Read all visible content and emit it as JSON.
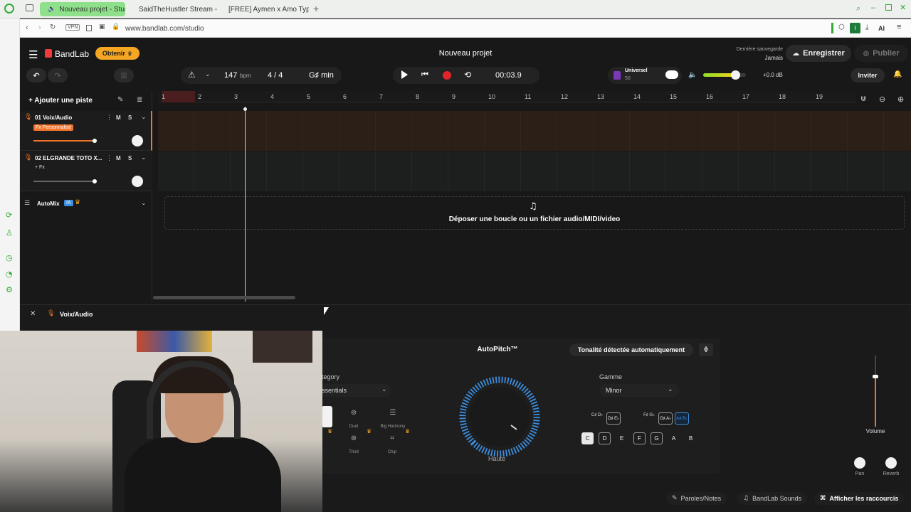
{
  "browser": {
    "tabs": [
      "Nouveau projet - Stud",
      "SaidTheHustler Stream - ",
      "[FREE] Aymen x Amo Type"
    ],
    "url": "www.bandlab.com/studio",
    "vpn": "VPN",
    "ai": "AI"
  },
  "header": {
    "brand": "BandLab",
    "obtenir": "Obtenir",
    "title": "Nouveau projet",
    "save_status_label": "Dernière sauvegarde",
    "save_status_value": "Jamais",
    "save_button": "Enregistrer",
    "publish_button": "Publier"
  },
  "transport": {
    "bpm": "147",
    "bpm_unit": "bpm",
    "signature": "4 / 4",
    "key": "G♯ min",
    "time": "00:03.9",
    "tuner_name": "Universel",
    "tuner_sub": "50",
    "gain": "+0.0 dB",
    "volume_level": 0.75,
    "invite": "Inviter"
  },
  "tracks": {
    "add_track": "Ajouter une piste",
    "items": [
      {
        "name": "01 Voix/Audio",
        "fx": "Fx Personnalisé",
        "mute": "M",
        "solo": "S"
      },
      {
        "name": "02 ELGRANDE TOTO X...",
        "fx": "+ Fx",
        "mute": "M",
        "solo": "S"
      }
    ],
    "automix": "AutoMix",
    "automix_badge": "IA"
  },
  "ruler": [
    "1",
    "2",
    "3",
    "4",
    "5",
    "6",
    "7",
    "8",
    "9",
    "10",
    "11",
    "12",
    "13",
    "14",
    "15",
    "16",
    "17",
    "18",
    "19"
  ],
  "dropzone": "Déposer une boucle ou un fichier audio/MIDI/video",
  "panel": {
    "track_name": "Voix/Audio",
    "category_label": "tegory",
    "category_value": "ssentials",
    "presets": [
      "Duet",
      "Big Harmony",
      "Third",
      "Chip"
    ],
    "autopitch_title": "AutoPitch™",
    "auto_key_button": "Tonalité détectée automatiquement",
    "knob_label": "Haute",
    "scale_label": "Gamme",
    "scale_value": "Minor",
    "sharps": [
      "C♯ D♭",
      "D♯ E♭",
      "F♯ G♭",
      "G♯ A♭",
      "A♯ B♭"
    ],
    "naturals": [
      "C",
      "D",
      "E",
      "F",
      "G",
      "A",
      "B"
    ],
    "volume_label": "Volume",
    "pan_label": "Pan",
    "reverb_label": "Reverb"
  },
  "footer": {
    "lyrics": "Paroles/Notes",
    "sounds": "BandLab Sounds",
    "shortcuts": "Afficher les raccourcis"
  },
  "colors": {
    "accent_orange": "#f0742c",
    "record_red": "#e0262b",
    "brand_red": "#f23a3a",
    "obtenir_yellow": "#f5a623",
    "autopitch_blue": "#3b8ee0"
  }
}
